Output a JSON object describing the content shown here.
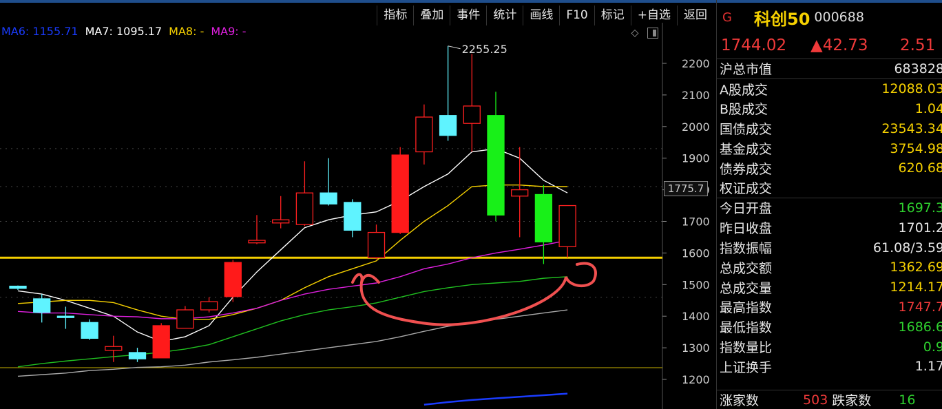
{
  "toolbar": {
    "buttons": [
      "指标",
      "叠加",
      "事件",
      "统计",
      "画线",
      "F10",
      "标记",
      "+自选",
      "返回"
    ]
  },
  "ma_legend": [
    {
      "label": "MA6: 1155.71",
      "color": "#1a3cff"
    },
    {
      "label": "MA7: 1095.17",
      "color": "#ffffff"
    },
    {
      "label": "MA8: -",
      "color": "#f5d000"
    },
    {
      "label": "MA9: -",
      "color": "#e020e0"
    }
  ],
  "chart_icons": [
    "diamond-icon",
    "panel-toggle-icon"
  ],
  "current_price_tag": "1775.7",
  "chart_data": {
    "type": "candlestick",
    "y_ticks": [
      1200,
      1300,
      1400,
      1500,
      1600,
      1700,
      1800,
      1900,
      2000,
      2100,
      2200
    ],
    "y_tick_labels": [
      "1200",
      "1300",
      "1400",
      "1500",
      "1600",
      "1700",
      "1800",
      "1900",
      "2000",
      "2100",
      "2200"
    ],
    "ylim": [
      1160,
      2300
    ],
    "peak_annotation": "2255.25",
    "candles": [
      {
        "o": 1495,
        "c": 1488,
        "h": 1497,
        "l": 1483,
        "color": "cyan"
      },
      {
        "o": 1455,
        "c": 1412,
        "h": 1470,
        "l": 1380,
        "color": "cyan"
      },
      {
        "o": 1400,
        "c": 1398,
        "h": 1430,
        "l": 1360,
        "color": "cyan"
      },
      {
        "o": 1380,
        "c": 1330,
        "h": 1390,
        "l": 1325,
        "color": "cyan"
      },
      {
        "o": 1292,
        "c": 1304,
        "h": 1338,
        "l": 1255,
        "color": "red"
      },
      {
        "o": 1285,
        "c": 1265,
        "h": 1300,
        "l": 1255,
        "color": "cyan"
      },
      {
        "o": 1268,
        "c": 1370,
        "h": 1378,
        "l": 1268,
        "color": "red-filled"
      },
      {
        "o": 1362,
        "c": 1420,
        "h": 1432,
        "l": 1362,
        "color": "red"
      },
      {
        "o": 1420,
        "c": 1446,
        "h": 1460,
        "l": 1412,
        "color": "red"
      },
      {
        "o": 1462,
        "c": 1570,
        "h": 1578,
        "l": 1445,
        "color": "red-filled"
      },
      {
        "o": 1632,
        "c": 1640,
        "h": 1720,
        "l": 1628,
        "color": "red"
      },
      {
        "o": 1695,
        "c": 1705,
        "h": 1780,
        "l": 1678,
        "color": "red"
      },
      {
        "o": 1690,
        "c": 1790,
        "h": 1890,
        "l": 1685,
        "color": "red"
      },
      {
        "o": 1790,
        "c": 1755,
        "h": 1900,
        "l": 1750,
        "color": "cyan"
      },
      {
        "o": 1760,
        "c": 1672,
        "h": 1770,
        "l": 1650,
        "color": "cyan"
      },
      {
        "o": 1585,
        "c": 1665,
        "h": 1690,
        "l": 1580,
        "color": "red"
      },
      {
        "o": 1665,
        "c": 1910,
        "h": 1935,
        "l": 1660,
        "color": "red-filled"
      },
      {
        "o": 1920,
        "c": 2030,
        "h": 2070,
        "l": 1880,
        "color": "red"
      },
      {
        "o": 2035,
        "c": 1972,
        "h": 2255,
        "l": 1955,
        "color": "cyan"
      },
      {
        "o": 2010,
        "c": 2065,
        "h": 2230,
        "l": 1920,
        "color": "red"
      },
      {
        "o": 2035,
        "c": 1720,
        "h": 2110,
        "l": 1700,
        "color": "green"
      },
      {
        "o": 1780,
        "c": 1800,
        "h": 1935,
        "l": 1650,
        "color": "red"
      },
      {
        "o": 1785,
        "c": 1635,
        "h": 1815,
        "l": 1565,
        "color": "green"
      },
      {
        "o": 1620,
        "c": 1750,
        "h": 1750,
        "l": 1585,
        "color": "red"
      }
    ],
    "ma_lines": [
      {
        "name": "white-short",
        "color": "#ffffff",
        "values": [
          1480,
          1470,
          1450,
          1425,
          1400,
          1350,
          1320,
          1335,
          1370,
          1460,
          1540,
          1610,
          1680,
          1705,
          1720,
          1730,
          1765,
          1810,
          1850,
          1920,
          1930,
          1900,
          1830,
          1790
        ]
      },
      {
        "name": "yellow",
        "color": "#f5d000",
        "values": [
          1440,
          1445,
          1450,
          1450,
          1443,
          1420,
          1400,
          1390,
          1390,
          1405,
          1425,
          1450,
          1490,
          1525,
          1550,
          1575,
          1640,
          1700,
          1750,
          1810,
          1815,
          1815,
          1810,
          1810
        ]
      },
      {
        "name": "magenta",
        "color": "#e020e0",
        "values": [
          1415,
          1410,
          1410,
          1405,
          1400,
          1398,
          1392,
          1392,
          1398,
          1410,
          1425,
          1450,
          1470,
          1485,
          1495,
          1505,
          1525,
          1550,
          1565,
          1585,
          1600,
          1612,
          1625,
          1640
        ]
      },
      {
        "name": "green",
        "color": "#20c020",
        "values": [
          1240,
          1250,
          1258,
          1265,
          1272,
          1278,
          1286,
          1296,
          1310,
          1335,
          1360,
          1385,
          1405,
          1420,
          1430,
          1442,
          1460,
          1478,
          1490,
          1500,
          1505,
          1510,
          1520,
          1525
        ]
      },
      {
        "name": "gray",
        "color": "#aaaaaa",
        "values": [
          1210,
          1215,
          1220,
          1228,
          1232,
          1238,
          1240,
          1245,
          1255,
          1262,
          1270,
          1280,
          1290,
          1300,
          1310,
          1320,
          1335,
          1352,
          1368,
          1380,
          1390,
          1400,
          1410,
          1420
        ]
      },
      {
        "name": "blue",
        "color": "#1a3cff",
        "values": [
          null,
          null,
          null,
          null,
          null,
          null,
          null,
          null,
          null,
          null,
          null,
          null,
          null,
          null,
          null,
          null,
          null,
          1120,
          1128,
          1135,
          1140,
          1145,
          1150,
          1155
        ]
      }
    ],
    "horizontal_lines": [
      {
        "value": 1585,
        "color": "#f5d000"
      },
      {
        "value": 1237,
        "color": "#c9b200"
      }
    ],
    "dashed_gridlines": [
      1930,
      1810,
      1700,
      1585,
      1460
    ]
  },
  "panel": {
    "marker": "G",
    "name": "科创50",
    "code": "000688",
    "price": "1744.02",
    "change": "▲42.73",
    "change_pct": "2.51",
    "stats": [
      {
        "label": "沪总市值",
        "value": "683828",
        "cls": "v-white",
        "sep": true
      },
      {
        "label": "A股成交",
        "value": "12088.03",
        "cls": "v-yellow",
        "sep": false
      },
      {
        "label": "B股成交",
        "value": "1.04",
        "cls": "v-yellow",
        "sep": false
      },
      {
        "label": "国债成交",
        "value": "23543.34",
        "cls": "v-yellow",
        "sep": false
      },
      {
        "label": "基金成交",
        "value": "3754.98",
        "cls": "v-yellow",
        "sep": false
      },
      {
        "label": "债券成交",
        "value": "620.68",
        "cls": "v-yellow",
        "sep": false
      },
      {
        "label": "权证成交",
        "value": "",
        "cls": "v-yellow",
        "sep": true
      },
      {
        "label": "今日开盘",
        "value": "1697.3",
        "cls": "v-green",
        "sep": false
      },
      {
        "label": "昨日收盘",
        "value": "1701.2",
        "cls": "v-white",
        "sep": false
      },
      {
        "label": "指数振幅",
        "value": "61.08/3.59",
        "cls": "v-white",
        "sep": false
      },
      {
        "label": "总成交额",
        "value": "1362.69",
        "cls": "v-yellow",
        "sep": false
      },
      {
        "label": "总成交量",
        "value": "1214.17",
        "cls": "v-yellow",
        "sep": false
      },
      {
        "label": "最高指数",
        "value": "1747.7",
        "cls": "v-red",
        "sep": false
      },
      {
        "label": "最低指数",
        "value": "1686.6",
        "cls": "v-green",
        "sep": false
      },
      {
        "label": "指数量比",
        "value": "0.9",
        "cls": "v-green",
        "sep": false
      },
      {
        "label": "上证换手",
        "value": "1.17",
        "cls": "v-white",
        "sep": false
      }
    ],
    "breadth": {
      "up_label": "涨家数",
      "up_value": "503",
      "down_label": "跌家数",
      "down_value": "16"
    }
  }
}
